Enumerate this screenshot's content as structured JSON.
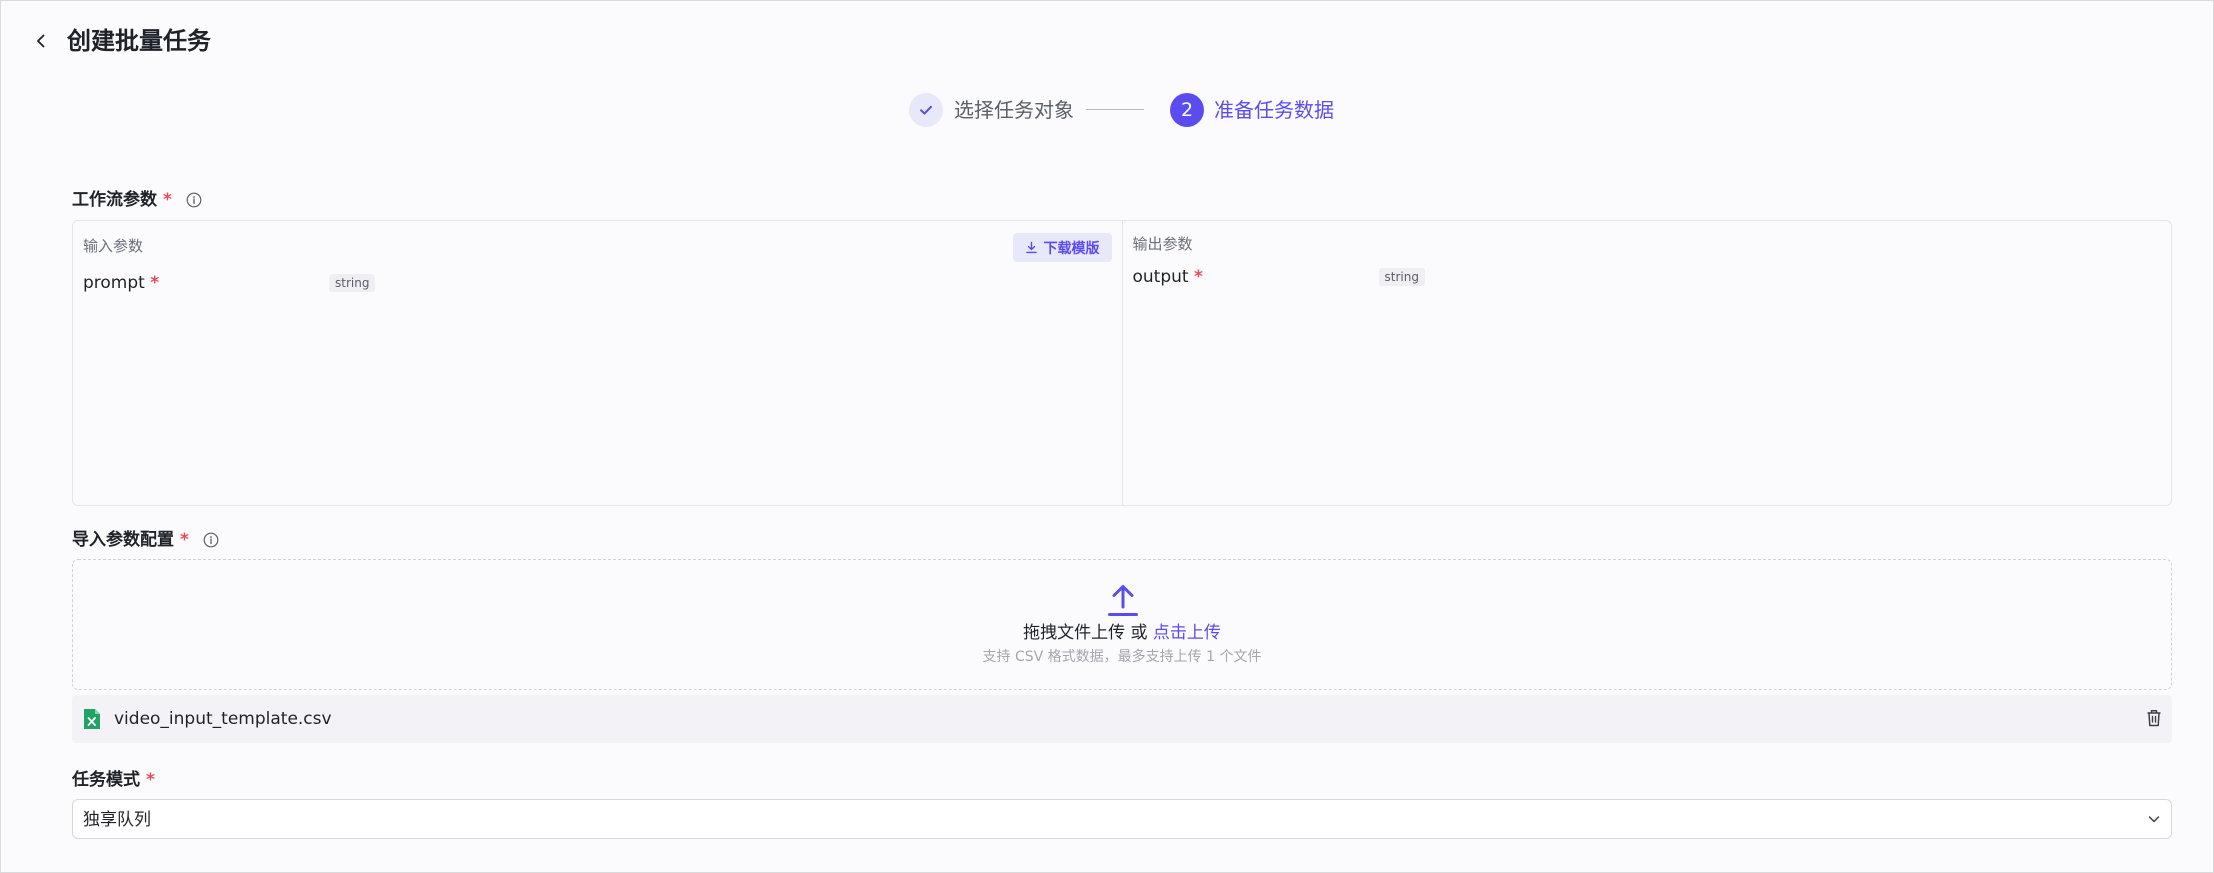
{
  "header": {
    "title": "创建批量任务"
  },
  "steps": [
    {
      "label": "选择任务对象",
      "state": "done"
    },
    {
      "number": "2",
      "label": "准备任务数据",
      "state": "active"
    }
  ],
  "workflow_params": {
    "label": "工作流参数",
    "required_mark": "*",
    "input": {
      "title": "输入参数",
      "download_label": "下载模版",
      "params": [
        {
          "name": "prompt",
          "required_mark": "*",
          "type": "string"
        }
      ]
    },
    "output": {
      "title": "输出参数",
      "params": [
        {
          "name": "output",
          "required_mark": "*",
          "type": "string"
        }
      ]
    }
  },
  "import_config": {
    "label": "导入参数配置",
    "required_mark": "*",
    "upload_text": "拖拽文件上传 或 ",
    "upload_link": "点击上传",
    "upload_hint": "支持 CSV 格式数据，最多支持上传 1 个文件"
  },
  "file": {
    "name": "video_input_template.csv"
  },
  "task_mode": {
    "label": "任务模式",
    "required_mark": "*",
    "value": "独享队列"
  },
  "colors": {
    "accent": "#5b4cf0",
    "required": "#e34d59",
    "excel_green": "#21a366"
  }
}
